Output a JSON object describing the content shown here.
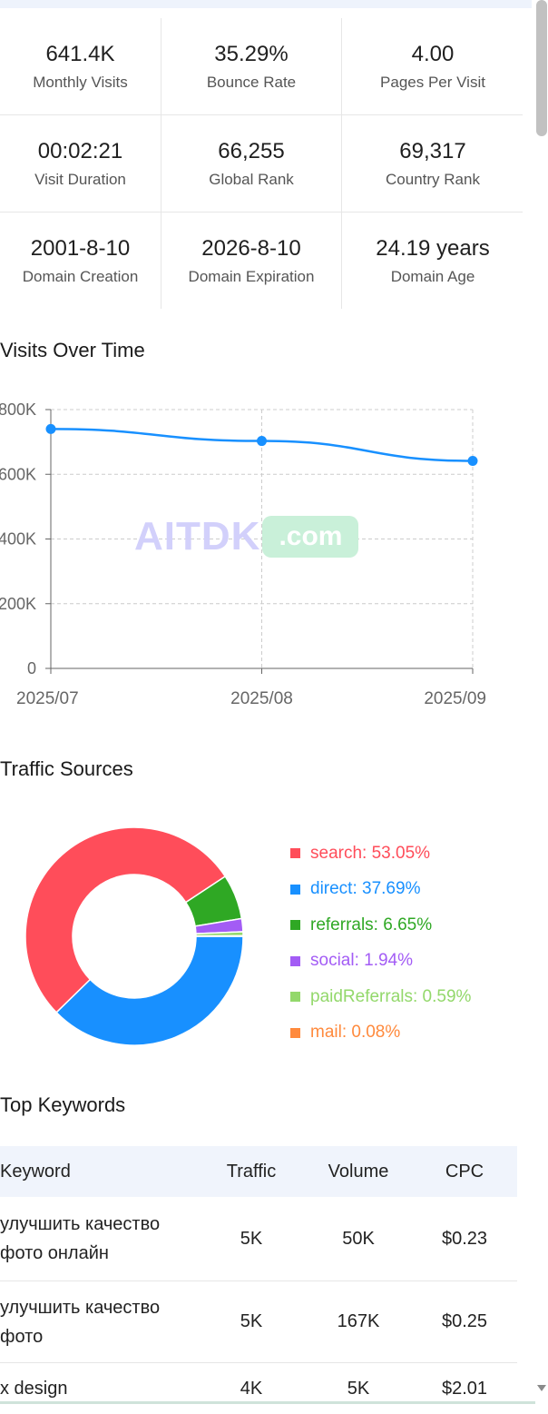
{
  "stats": [
    {
      "value": "641.4K",
      "label": "Monthly Visits"
    },
    {
      "value": "35.29%",
      "label": "Bounce Rate"
    },
    {
      "value": "4.00",
      "label": "Pages Per Visit"
    },
    {
      "value": "00:02:21",
      "label": "Visit Duration"
    },
    {
      "value": "66,255",
      "label": "Global Rank"
    },
    {
      "value": "69,317",
      "label": "Country Rank"
    },
    {
      "value": "2001-8-10",
      "label": "Domain Creation"
    },
    {
      "value": "2026-8-10",
      "label": "Domain Expiration"
    },
    {
      "value": "24.19 years",
      "label": "Domain Age"
    }
  ],
  "sections": {
    "visits_title": "Visits Over Time",
    "traffic_title": "Traffic Sources",
    "keywords_title": "Top Keywords"
  },
  "watermark": {
    "brand": "AITDK",
    "suffix": ".com"
  },
  "chart_data": [
    {
      "type": "line",
      "x": [
        "2025/07",
        "2025/08",
        "2025/09"
      ],
      "series": [
        {
          "values": [
            740000,
            703000,
            641400
          ],
          "color": "#1890ff"
        }
      ],
      "ylim": [
        0,
        800000
      ],
      "yticks": [
        0,
        200000,
        400000,
        600000,
        800000
      ],
      "ytick_labels": [
        "0",
        "200K",
        "400K",
        "600K",
        "800K"
      ],
      "grid": true,
      "title": "",
      "xlabel": "",
      "ylabel": ""
    },
    {
      "type": "pie",
      "donut": true,
      "slices": [
        {
          "name": "search",
          "value": 53.05,
          "label": "search: 53.05%",
          "color": "#ff4d5a"
        },
        {
          "name": "direct",
          "value": 37.69,
          "label": "direct: 37.69%",
          "color": "#1890ff"
        },
        {
          "name": "referrals",
          "value": 6.65,
          "label": "referrals: 6.65%",
          "color": "#2fa824"
        },
        {
          "name": "social",
          "value": 1.94,
          "label": "social: 1.94%",
          "color": "#a35cf5"
        },
        {
          "name": "paidReferrals",
          "value": 0.59,
          "label": "paidReferrals: 0.59%",
          "color": "#93d86b"
        },
        {
          "name": "mail",
          "value": 0.08,
          "label": "mail: 0.08%",
          "color": "#ff8a3d"
        }
      ],
      "legend_placement": "right"
    }
  ],
  "keywords": {
    "headers": {
      "keyword": "Keyword",
      "traffic": "Traffic",
      "volume": "Volume",
      "cpc": "CPC"
    },
    "rows": [
      {
        "keyword": "улучшить качество фото онлайн",
        "traffic": "5K",
        "volume": "50K",
        "cpc": "$0.23"
      },
      {
        "keyword": "улучшить качество фото",
        "traffic": "5K",
        "volume": "167K",
        "cpc": "$0.25"
      },
      {
        "keyword": "x design",
        "traffic": "4K",
        "volume": "5K",
        "cpc": "$2.01"
      }
    ]
  }
}
